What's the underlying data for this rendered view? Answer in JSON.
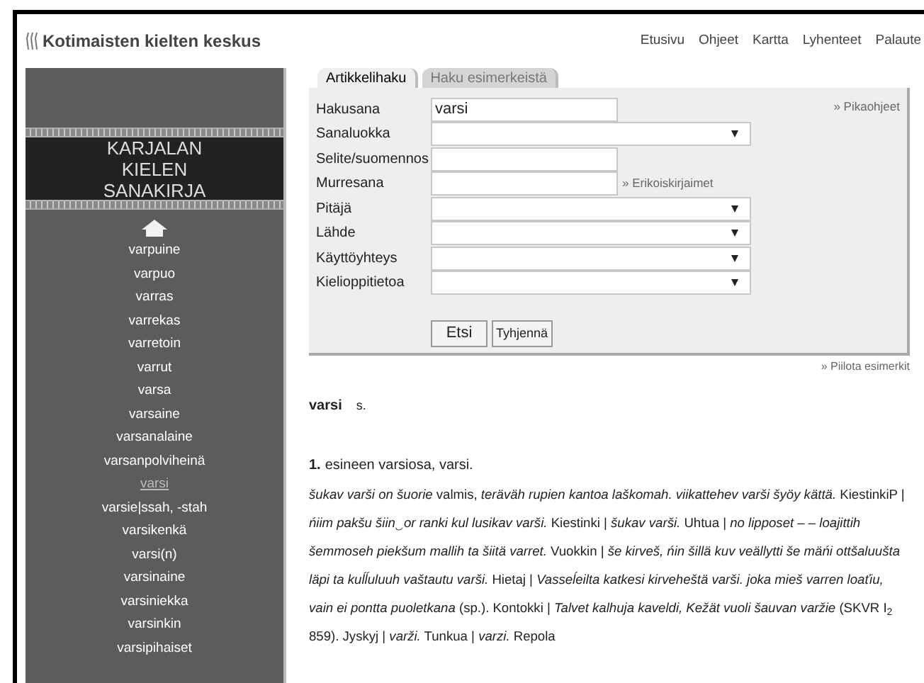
{
  "header": {
    "logo": "Kotimaisten kielten keskus",
    "nav": [
      "Etusivu",
      "Ohjeet",
      "Kartta",
      "Lyhenteet",
      "Palaute"
    ]
  },
  "sidebar": {
    "title": [
      "KARJALAN",
      "KIELEN",
      "SANAKIRJA"
    ],
    "items": [
      {
        "label": "varpuine",
        "selected": false
      },
      {
        "label": "varpuo",
        "selected": false
      },
      {
        "label": "varras",
        "selected": false
      },
      {
        "label": "varrekas",
        "selected": false
      },
      {
        "label": "varretoin",
        "selected": false
      },
      {
        "label": "varrut",
        "selected": false
      },
      {
        "label": "varsa",
        "selected": false
      },
      {
        "label": "varsaine",
        "selected": false
      },
      {
        "label": "varsanalaine",
        "selected": false
      },
      {
        "label": "varsanpolviheinä",
        "selected": false
      },
      {
        "label": "varsi",
        "selected": true
      },
      {
        "label": "varsie|ssah, -stah",
        "selected": false
      },
      {
        "label": "varsikenkä",
        "selected": false
      },
      {
        "label": "varsi(n)",
        "selected": false
      },
      {
        "label": "varsinaine",
        "selected": false
      },
      {
        "label": "varsiniekka",
        "selected": false
      },
      {
        "label": "varsinkin",
        "selected": false
      },
      {
        "label": "varsipihaiset",
        "selected": false
      }
    ]
  },
  "tabs": [
    {
      "label": "Artikkelihaku",
      "selected": true
    },
    {
      "label": "Haku esimerkeistä",
      "selected": false
    }
  ],
  "form": {
    "help_link": "» Pikaohjeet",
    "fields": [
      {
        "label": "Hakusana",
        "kind": "text",
        "value": "varsi"
      },
      {
        "label": "Sanaluokka",
        "kind": "select"
      },
      {
        "label": "Selite/suomennos",
        "kind": "text"
      },
      {
        "label": "Murresana",
        "kind": "text",
        "link": "» Erikoiskirjaimet"
      },
      {
        "label": "Pitäjä",
        "kind": "select"
      },
      {
        "label": "Lähde",
        "kind": "select"
      },
      {
        "label": "Käyttöyhteys",
        "kind": "select"
      },
      {
        "label": "Kielioppitietoa",
        "kind": "select"
      }
    ],
    "buttons": [
      "Etsi",
      "Tyhjennä"
    ]
  },
  "hide_link": "» Piilota esimerkit",
  "entry": {
    "headword": "varsi",
    "pos": "s.",
    "sense_number": "1.",
    "definition": "esineen varsiosa, varsi.",
    "examples": "*šukav varši on šuorie* valmis, *teräväh rupien kantoa laškomah. viikattehev varši šyöy kättä.* KiestinkiP | *ńiim pakšu šiin‿or ranki kul lusikav varši.* Kiestinki | *šukav varši.* Uhtua | *no lipposet – – loajittih šemmoseh piekšum mallih ta šiitä varret.* Vuokkin | *še kirveš, ńin šillä kuv veällytti še mäńi ottšaluušta läpi ta kuĺĺuluuh vaštautu varši.* Hietaj | *Vasseĺeilta katkesi kirveheštä varši. joka mieš varren loaťiu, vain ei pontta puoletkana* (sp.). Kontokki | *Talvet kalhuja kaveldi, Kežät vuoli šauvan varžie* (SKVR I$_{2}$ 859). Jyskyj | *varži.* Tunkua | *varzi.* Repola"
  }
}
